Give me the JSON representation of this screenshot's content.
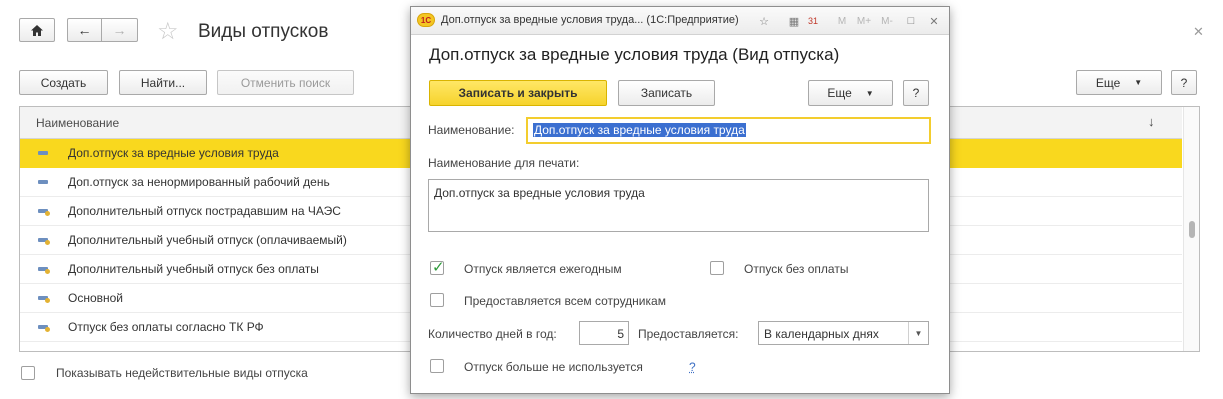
{
  "form": {
    "title": "Виды отпусков",
    "toolbar": {
      "create_label": "Создать",
      "find_label": "Найти...",
      "cancel_search_label": "Отменить поиск",
      "more_label": "Еще",
      "help_label": "?"
    },
    "grid": {
      "column_header": "Наименование",
      "rows": [
        {
          "label": "Доп.отпуск за вредные условия труда",
          "icon": "list-item-icon",
          "selected": true
        },
        {
          "label": "Доп.отпуск за ненормированный рабочий день",
          "icon": "list-item-icon",
          "selected": false
        },
        {
          "label": "Дополнительный отпуск пострадавшим на ЧАЭС",
          "icon": "predefined-item-icon",
          "selected": false
        },
        {
          "label": "Дополнительный учебный отпуск (оплачиваемый)",
          "icon": "predefined-item-icon",
          "selected": false
        },
        {
          "label": "Дополнительный учебный отпуск без оплаты",
          "icon": "predefined-item-icon",
          "selected": false
        },
        {
          "label": "Основной",
          "icon": "predefined-item-icon",
          "selected": false
        },
        {
          "label": "Отпуск без оплаты согласно ТК РФ",
          "icon": "predefined-item-icon",
          "selected": false
        }
      ]
    },
    "show_invalid_label": "Показывать недействительные виды отпуска",
    "show_invalid_checked": false
  },
  "modal": {
    "window_title": "Доп.отпуск за вредные условия труда...  (1С:Предприятие)",
    "app_logo_text": "1С",
    "heading": "Доп.отпуск за вредные условия труда (Вид отпуска)",
    "save_close_label": "Записать и закрыть",
    "save_label": "Записать",
    "more_label": "Еще",
    "help_label": "?",
    "title_icons": {
      "m": "M",
      "mplus": "M+",
      "mminus": "M-",
      "calendar_day": "31"
    },
    "name_label": "Наименование:",
    "name_value": "Доп.отпуск за вредные условия труда",
    "print_name_label": "Наименование для печати:",
    "print_name_value": "Доп.отпуск за вредные условия труда",
    "annual_label": "Отпуск является ежегодным",
    "annual_checked": true,
    "unpaid_label": "Отпуск без оплаты",
    "unpaid_checked": false,
    "all_employees_label": "Предоставляется всем сотрудникам",
    "all_employees_checked": false,
    "days_label": "Количество дней в год:",
    "days_value": "5",
    "provided_label": "Предоставляется:",
    "provided_value": "В календарных днях",
    "not_used_label": "Отпуск больше не используется",
    "not_used_checked": false,
    "help_link": "?"
  },
  "colors": {
    "accent_yellow": "#f9d81e",
    "selection_blue": "#3b6fd0",
    "check_green": "#2e9a3a",
    "link_blue": "#3c6fc4"
  }
}
